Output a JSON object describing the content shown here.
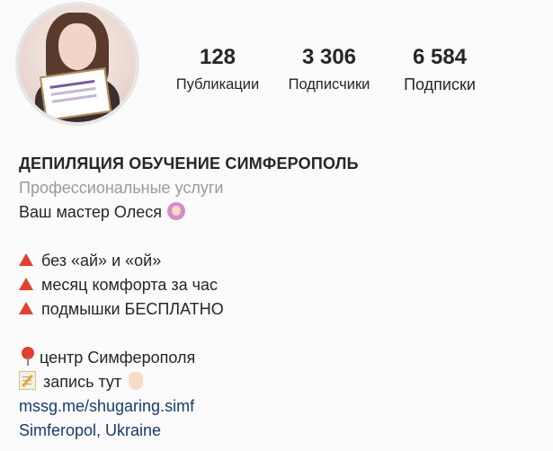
{
  "profile": {
    "posts": {
      "count": "128",
      "label": "Публикации"
    },
    "followers": {
      "count": "3 306",
      "label": "Подписчики"
    },
    "following": {
      "count": "6 584",
      "label": "Подписки"
    }
  },
  "bio": {
    "name": "ДЕПИЛЯЦИЯ ОБУЧЕНИЕ СИМФЕРОПОЛЬ",
    "category": "Профессиональные услуги",
    "intro": "Ваш мастер Олеся",
    "bullets": [
      "без «ай» и «ой»",
      "месяц комфорта за час",
      "подмышки БЕСПЛАТНО"
    ],
    "location_line": "центр Симферополя",
    "booking_line": "запись тут",
    "link": "mssg.me/shugaring.simf",
    "location": "Simferopol, Ukraine"
  },
  "icons": {
    "bullet": "red-triangle-icon",
    "location": "round-pushpin-icon",
    "booking": "memo-icon",
    "pointing": "pointing-down-icon",
    "intro": "woman-raising-hand-icon"
  },
  "colors": {
    "background": "#fbfbfb",
    "text": "#262626",
    "muted": "#9a9a9a",
    "link": "#1a3b6b",
    "bullet": "#e2412f"
  }
}
